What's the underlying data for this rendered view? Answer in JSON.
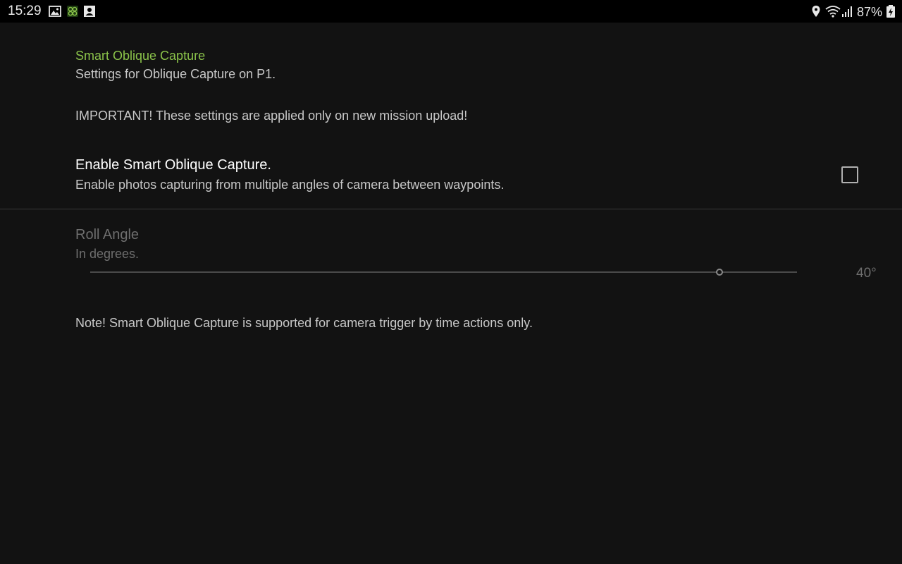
{
  "status_bar": {
    "time": "15:29",
    "battery_percent": "87%",
    "icons_left": [
      "gallery-icon",
      "app-notification-icon",
      "contact-icon"
    ],
    "icons_right": [
      "location-icon",
      "wifi-icon",
      "signal-icon",
      "battery-icon"
    ]
  },
  "colors": {
    "accent": "#8bc34a",
    "background": "#121212",
    "status_bar": "#000000"
  },
  "category": {
    "title": "Smart Oblique Capture",
    "subtitle": "Settings for Oblique Capture on P1."
  },
  "important_notice": "IMPORTANT! These settings are applied only on new mission upload!",
  "enable_pref": {
    "title": "Enable Smart Oblique Capture.",
    "summary": "Enable photos capturing from multiple angles of camera between waypoints.",
    "checked": false
  },
  "roll_angle": {
    "title": "Roll Angle",
    "summary": "In degrees.",
    "value": 40,
    "value_label": "40°",
    "slider_fraction": 0.89,
    "enabled": false
  },
  "note": "Note! Smart Oblique Capture is supported for camera trigger by time actions only."
}
